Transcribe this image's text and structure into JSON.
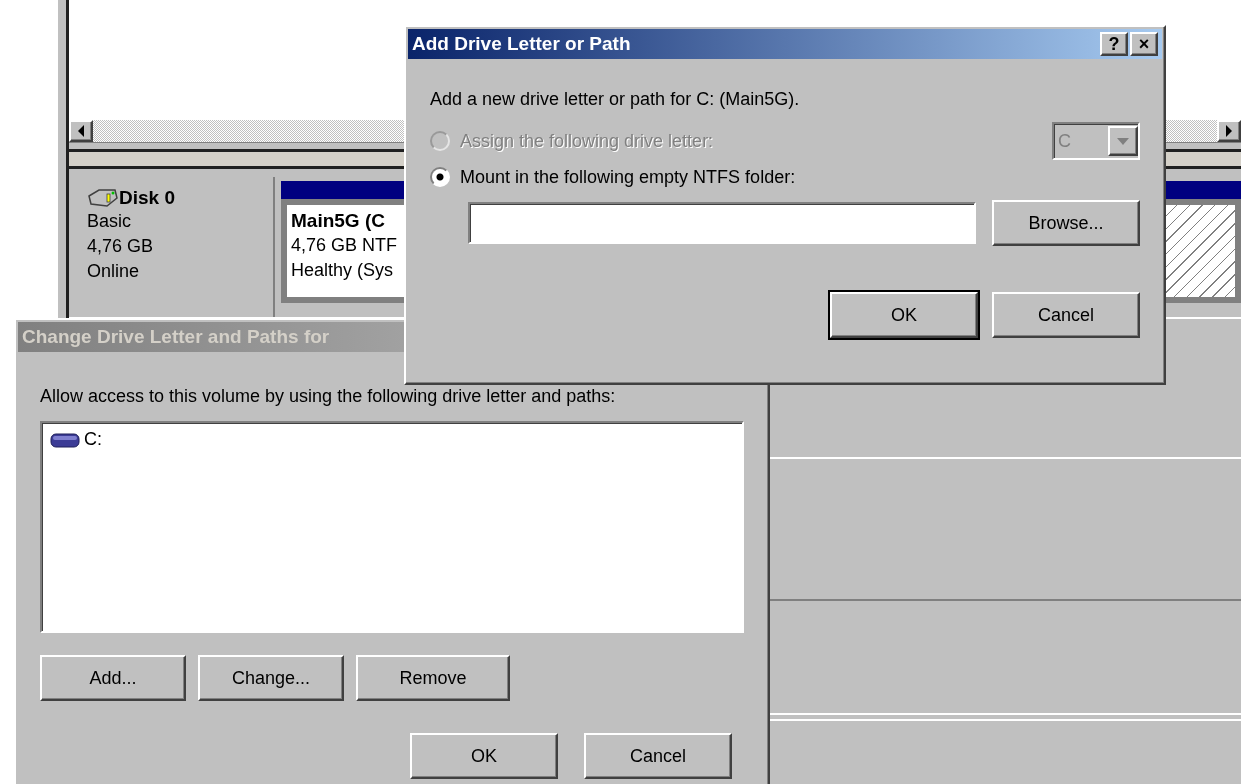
{
  "disk_view": {
    "disk": {
      "name": "Disk 0",
      "type": "Basic",
      "size": "4,76 GB",
      "status": "Online"
    },
    "volume": {
      "name": "Main5G (C",
      "size": "4,76 GB NTF",
      "status": "Healthy (Sys"
    }
  },
  "change_dialog": {
    "title": "Change Drive Letter and Paths for",
    "active": false,
    "description": "Allow access to this volume by using the following drive letter and paths:",
    "paths": [
      {
        "label": "C:",
        "selected": false
      }
    ],
    "buttons": [
      "Add...",
      "Change...",
      "Remove"
    ],
    "footer_buttons": [
      "OK",
      "Cancel"
    ]
  },
  "add_dialog": {
    "title": "Add Drive Letter or Path",
    "active": true,
    "title_buttons": [
      "?",
      "×"
    ],
    "description": "Add a new drive letter or path for C: (Main5G).",
    "options": [
      {
        "label": "Assign the following drive letter:",
        "selected": false,
        "disabled": true
      },
      {
        "label": "Mount in the following empty NTFS folder:",
        "selected": true,
        "disabled": false
      }
    ],
    "drive_letter": {
      "value": "C",
      "disabled": true
    },
    "browse_button": "Browse...",
    "buttons": [
      "OK",
      "Cancel"
    ]
  }
}
